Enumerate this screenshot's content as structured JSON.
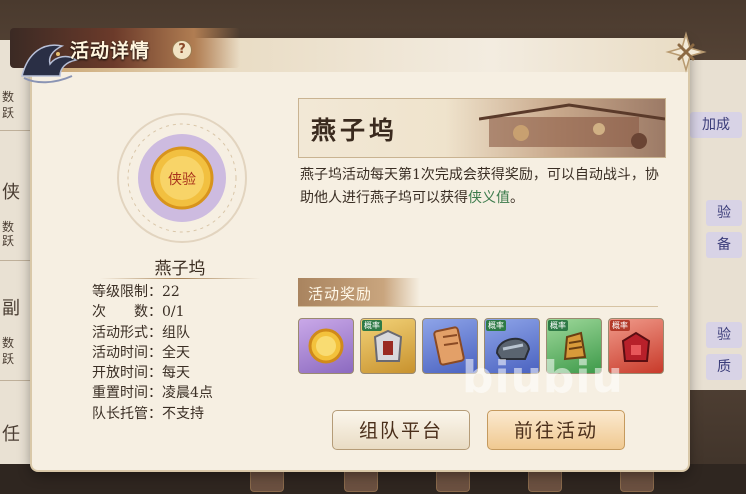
{
  "dialog": {
    "title": "活动详情",
    "help_glyph": "?"
  },
  "activity": {
    "name": "燕子坞",
    "emblem_text": "侠验",
    "info": [
      "等级限制：22",
      "次　　数：0/1",
      "活动形式：组队",
      "活动时间：全天",
      "开放时间：每天",
      "重置时间：凌晨4点",
      "队长托管：不支持"
    ],
    "description_part1": "燕子坞活动每天第1次完成会获得奖励，可以自动战斗，协助他人进行燕子坞可以获得",
    "description_highlight": "侠义值",
    "description_end": "。"
  },
  "rewards": {
    "title": "活动奖励",
    "items": [
      {
        "icon": "xia-coin-icon",
        "tag": ""
      },
      {
        "icon": "armor-icon",
        "tag": "概率"
      },
      {
        "icon": "scroll-icon",
        "tag": ""
      },
      {
        "icon": "helmet-icon",
        "tag": "概率"
      },
      {
        "icon": "gauntlet-icon",
        "tag": "概率"
      },
      {
        "icon": "red-armor-icon",
        "tag": "概率"
      }
    ]
  },
  "buttons": {
    "team_platform": "组队平台",
    "go_activity": "前往活动"
  },
  "background": {
    "left_rows": [
      "数",
      "跃",
      "侠",
      "数",
      "跃",
      "副",
      "数",
      "跃",
      "任"
    ],
    "right_buttons": [
      "加成",
      "验",
      "备",
      "验",
      "质"
    ]
  },
  "watermark": "biubiu",
  "colors": {
    "highlight_green": "#3a7a4a",
    "dialog_bg": "#f6efe2",
    "title_gold": "#fff4dd"
  }
}
